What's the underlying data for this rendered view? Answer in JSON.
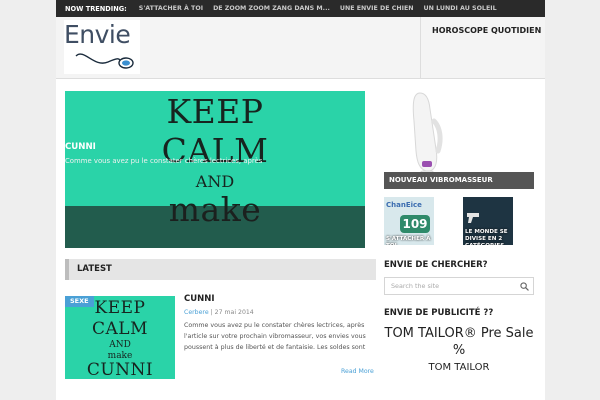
{
  "trending": {
    "label": "NOW TRENDING:",
    "items": [
      "S'ATTACHER À TOI",
      "DE ZOOM ZOOM ZANG DANS M...",
      "UNE ENVIE DE CHIEN",
      "UN LUNDI AU SOLEIL"
    ]
  },
  "header": {
    "logo_text": "Envie",
    "nav": [
      "HOROSCOPE QUOTIDIEN"
    ]
  },
  "featured": {
    "poster": [
      "KEEP",
      "CALM",
      "AND",
      "make"
    ],
    "title": "CUNNI",
    "excerpt": "Comme vous avez pu le constater chères lectrices, après"
  },
  "latest": {
    "label": "LATEST",
    "post": {
      "category": "SEXE",
      "poster": [
        "KEEP",
        "CALM",
        "AND",
        "make",
        "CUNNI"
      ],
      "title": "CUNNI",
      "author": "Cerbere",
      "date": "27 mai 2014",
      "excerpt": "Comme vous avez pu le constater chères lectrices, après l'article sur votre prochain vibromasseur, vos envies vous poussent à plus de liberté et de fantaisie. Les soldes sont",
      "read_more": "Read More"
    }
  },
  "sidebar": {
    "featured_label": "NOUVEAU VIBROMASSEUR",
    "thumb_a": {
      "caption": "S'ATTACHER À TOI",
      "badge": "109",
      "word": "ChanEice"
    },
    "thumb_b": {
      "caption": "LE MONDE SE DIVISE EN 2 CATÉGORIES"
    },
    "search_heading": "ENVIE DE CHERCHER?",
    "search_placeholder": "Search the site",
    "ad_heading": "ENVIE DE PUBLICITÉ ??",
    "ad_line1": "TOM TAILOR® Pre Sale %",
    "ad_line2": "TOM TAILOR"
  },
  "colors": {
    "accent": "#4aa0d6",
    "featured_bg": "#2ad3a8",
    "trending_bg": "#2a2a2a"
  }
}
